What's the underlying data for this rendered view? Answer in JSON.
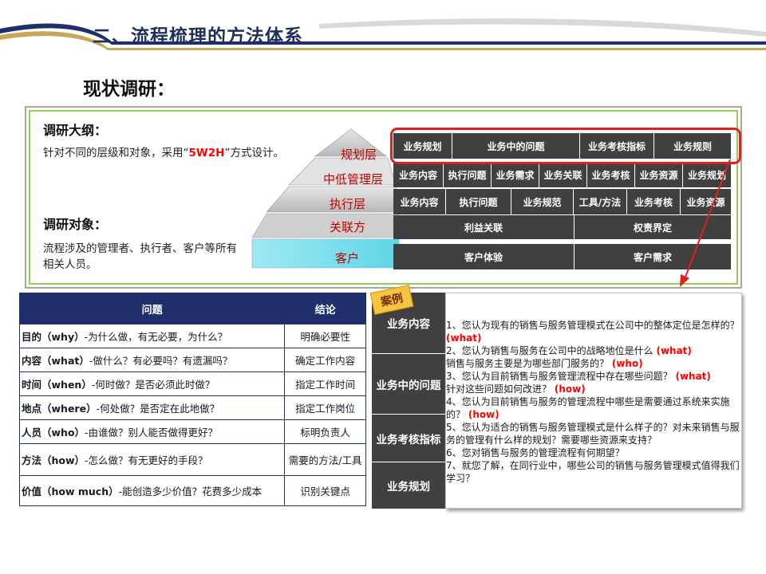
{
  "header": {
    "title": "二、流程梳理的方法体系"
  },
  "section": {
    "heading": "现状调研："
  },
  "outline": {
    "heading1": "调研大纲：",
    "text1_before": "针对不同的层级和对象，采用“",
    "text1_accent": "5W2H",
    "text1_after": "”方式设计。",
    "heading2": "调研对象：",
    "text2": "流程涉及的管理者、执行者、客户等所有相关人员。"
  },
  "pyramid": {
    "layers": [
      {
        "label": "规划层",
        "cells": [
          "业务规划",
          "业务中的问题",
          "业务考核指标",
          "业务规则"
        ]
      },
      {
        "label": "中低管理层",
        "cells": [
          "业务内容",
          "执行问题",
          "业务需求",
          "业务关联",
          "业务考核",
          "业务资源",
          "业务规划"
        ]
      },
      {
        "label": "执行层",
        "cells": [
          "业务内容",
          "执行问题",
          "业务规范",
          "工具/方法",
          "业务考核",
          "业务资源"
        ]
      },
      {
        "label": "关联方",
        "cells": [
          "利益关联",
          "权责界定"
        ]
      },
      {
        "label": "客户",
        "cells": [
          "客户体验",
          "客户需求"
        ]
      }
    ]
  },
  "table": {
    "headers": [
      "问题",
      "结论"
    ],
    "rows": [
      {
        "key": "目的（why）",
        "question": "-为什么做，有无必要，为什么？",
        "result": "明确必要性"
      },
      {
        "key": "内容（what）",
        "question": "-做什么？有必要吗？有遗漏吗？",
        "result": "确定工作内容"
      },
      {
        "key": "时间（when）",
        "question": "-何时做？是否必须此时做？",
        "result": "指定工作时间"
      },
      {
        "key": "地点（where）",
        "question": "-何处做？是否定在此地做？",
        "result": "指定工作岗位"
      },
      {
        "key": "人员（who）",
        "question": "-由谁做？别人能否做得更好？",
        "result": "标明负责人"
      },
      {
        "key": "方法（how）",
        "question": "-怎么做？有无更好的手段？",
        "result": "需要的方法/工具"
      },
      {
        "key": "价值（how much）",
        "question": "-能创造多少价值？花费多少成本",
        "result": "识别关键点"
      }
    ]
  },
  "case": {
    "badge": "案例",
    "sides": [
      "业务内容",
      "业务中的问题",
      "业务考核指标",
      "业务规划"
    ],
    "lines": [
      {
        "text": "1、您认为现有的销售与服务管理模式在公司中的整体定位是怎样的？",
        "tag": "(what)"
      },
      {
        "text": "2、您认为销售与服务在公司中的战略地位是什么",
        "tag": "(what)"
      },
      {
        "text": "销售与服务主要是为哪些部门服务的？",
        "tag": "(who)"
      },
      {
        "text": "3、您认为目前销售与服务管理流程中存在哪些问题？",
        "tag": "(what)"
      },
      {
        "text": "针对这些问题如何改进？",
        "tag": "(how)"
      },
      {
        "text": "4、您认为目前销售与服务的管理流程中哪些是需要通过系统来实施的？",
        "tag": "(how)"
      },
      {
        "text": "5、您认为适合的销售与服务管理模式是什么样子的？对未来销售与服务的管理有什么样的规划？需要哪些资源来支持？",
        "tag": ""
      },
      {
        "text": "6、您对销售与服务的管理流程有何期望？",
        "tag": ""
      },
      {
        "text": "7、就您了解，在同行业中，哪些公司的销售与服务管理模式值得我们学习？",
        "tag": ""
      }
    ]
  },
  "colors": {
    "accent_red": "#e0201f",
    "navy": "#1f2f6b",
    "dark_cell": "#404040",
    "green_frame": "#92d050"
  }
}
